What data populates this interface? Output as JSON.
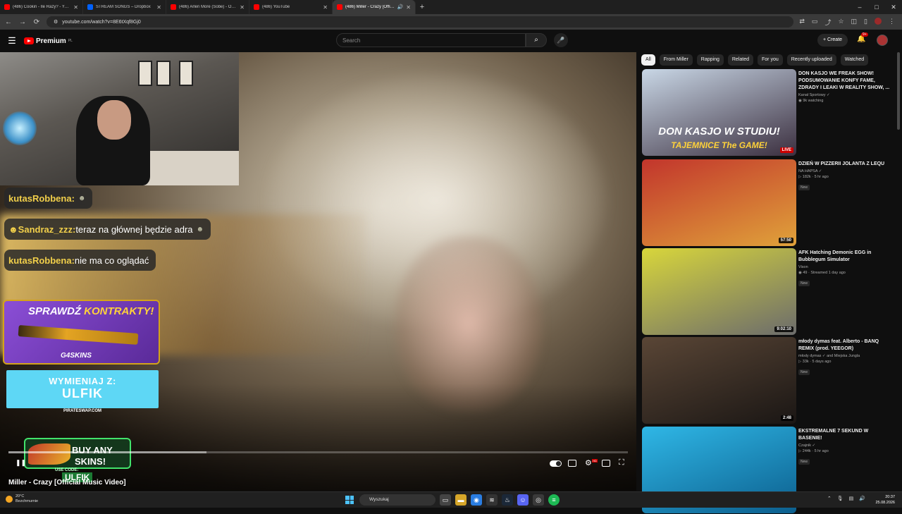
{
  "browser": {
    "tabs": [
      {
        "label": "(486) Cookin - Ile Razy? - YouTube",
        "icon": "youtube-icon"
      },
      {
        "label": "STREAM SONGS – Dropbox",
        "icon": "dropbox-icon"
      },
      {
        "label": "(486) Arlen More (Sobe) - OH M",
        "icon": "youtube-icon"
      },
      {
        "label": "(486) YouTube",
        "icon": "youtube-icon"
      },
      {
        "label": "(486) Miller - Crazy [Official",
        "icon": "youtube-icon",
        "active": true
      }
    ],
    "new_tab": "+",
    "url": "youtube.com/watch?v=8E6tXqf8Gj0",
    "window_controls": [
      "–",
      "□",
      "✕"
    ]
  },
  "header": {
    "menu_icon": "☰",
    "logo_text": "Premium",
    "logo_region": "PL",
    "search_placeholder": "Search",
    "search_icon": "⌕",
    "mic_icon": "🎤",
    "create_label": "+ Create",
    "notif_badge": "9+",
    "bell_icon": "🔔"
  },
  "stream": {
    "chat": [
      {
        "nick": "kutasRobbena:",
        "text": "",
        "emote": "☻"
      },
      {
        "nick": "☻Sandraz_zzz:",
        "text": " teraz na głównej będzie adra",
        "emote": "☻"
      },
      {
        "nick": "kutasRobbena:",
        "text": " nie ma co oglądać",
        "emote": ""
      }
    ],
    "ad1": {
      "line_white": "SPRAWDŹ ",
      "line_yellow": "KONTRAKTY!",
      "brand": "G4SKINS"
    },
    "ad2": {
      "line1": "WYMIENIAJ Z:",
      "line2": "ULFIK",
      "sub": "PIRATESWAP.COM"
    },
    "ad3": {
      "line1": "BUY ANY",
      "line2": "SKINS!",
      "code_label": "USE CODE:",
      "code": "ULFIK"
    }
  },
  "player": {
    "title": "Miller - Crazy [Official Music Video]",
    "progress": 0.0,
    "buffered": 0.32,
    "controls": {
      "pause": "❚❚",
      "hd": "HD",
      "fullscreen": "⛶"
    }
  },
  "rail": {
    "chips": [
      "All",
      "From Miller",
      "Rapping",
      "Related",
      "For you",
      "Recently uploaded",
      "Watched"
    ],
    "videos": [
      {
        "title": "DON KASJO WE FREAK SHOW! PODSUMOWANIE KONFY FAME, ZDRADY I LEAKI W REALITY SHOW, ...",
        "channel": "Kanał Sportowy ✓",
        "stats": "◉ 9k watching",
        "badge": "",
        "thumb_text": "DON KASJO W STUDIU!",
        "thumb_text2": "TAJEMNICE The GAME!",
        "corner": "LIVE",
        "colors": [
          "#c9d7e6",
          "#3b2f3f"
        ]
      },
      {
        "title": "DZIEŃ W PIZZERII JOLANTA Z LEQU",
        "channel": "NA HAPSA ✓",
        "stats": "▷ 182k · 5 hr ago",
        "badge": "New",
        "thumb_text": "",
        "thumb_text2": "",
        "corner": "57:50",
        "colors": [
          "#c2352c",
          "#e0a23a"
        ]
      },
      {
        "title": "AFK Hatching Demonic EGG in Bubblegum Simulator",
        "channel": "Vison",
        "stats": "◉ 49 · Streamed 1 day ago",
        "badge": "New",
        "thumb_text": "",
        "thumb_text2": "",
        "corner": "9:02:10",
        "colors": [
          "#d8d63b",
          "#6c6c6c"
        ]
      },
      {
        "title": "młody dymas feat. Alberto - BANQ REMIX (prod. YEEGOR)",
        "channel": "młody dymas ✓ and Miejska Jungla",
        "stats": "▷ 33k · 5 days ago",
        "badge": "New",
        "thumb_text": "",
        "thumb_text2": "",
        "corner": "2:48",
        "colors": [
          "#5a4636",
          "#1a1614"
        ]
      },
      {
        "title": "EKSTREMALNE 7 SEKUND W BASENIE!",
        "channel": "Czajnik ✓",
        "stats": "▷ 244k · 5 hr ago",
        "badge": "New",
        "thumb_text": "",
        "thumb_text2": "",
        "corner": "",
        "colors": [
          "#2fb7e6",
          "#0c5f8e"
        ]
      }
    ]
  },
  "taskbar": {
    "temp": "20°C",
    "weather": "Bezchmurnie",
    "search": "Wyszukaj",
    "time": "20:37",
    "date": "25.08.2026"
  }
}
